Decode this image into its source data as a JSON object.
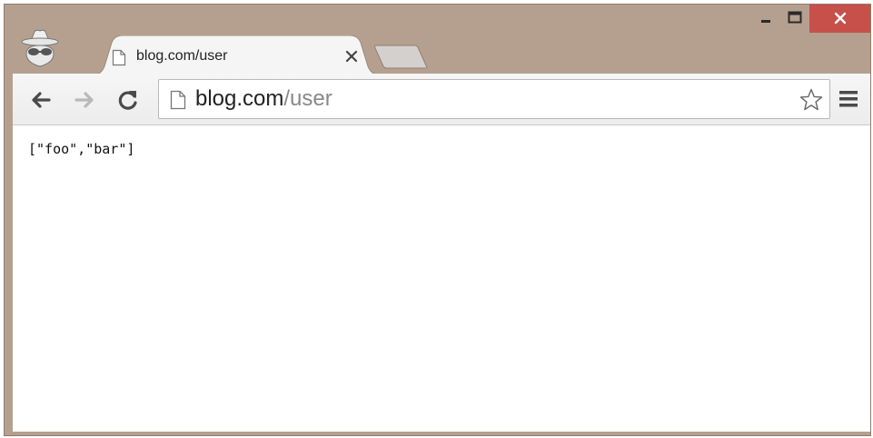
{
  "window": {
    "colors": {
      "frame": "#b5a08f",
      "close_button": "#c7504b"
    },
    "controls": [
      "minimize-icon",
      "maximize-icon",
      "close-icon"
    ]
  },
  "tab": {
    "title": "blog.com/user",
    "favicon": "page-icon",
    "close": "close-icon"
  },
  "toolbar": {
    "back": "back-arrow-icon",
    "forward": "forward-arrow-icon",
    "reload": "reload-icon",
    "address": {
      "host": "blog.com",
      "path": "/user"
    },
    "bookmark": "star-icon",
    "menu": "hamburger-menu-icon"
  },
  "content": {
    "body_text": "[\"foo\",\"bar\"]"
  }
}
